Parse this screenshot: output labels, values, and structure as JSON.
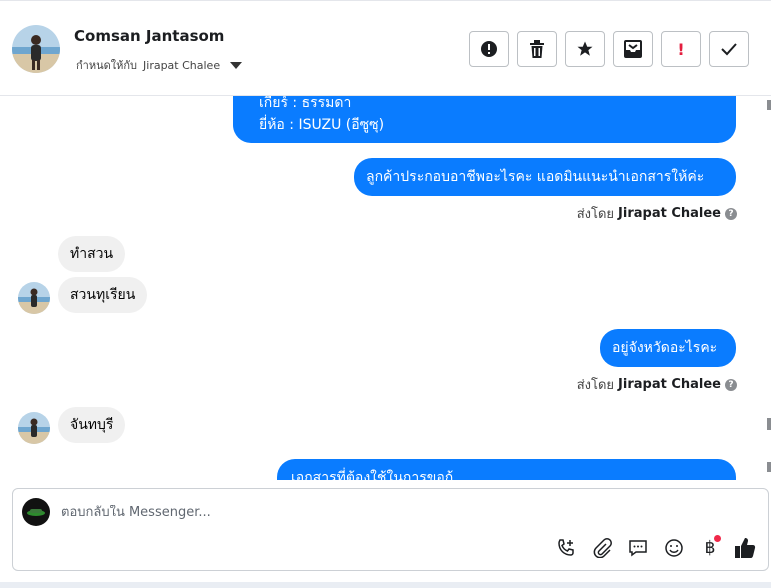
{
  "header": {
    "contact_name": "Comsan Jantasom",
    "assign_prefix": "กำหนดให้กับ",
    "assignee": "Jirapat Chalee",
    "actions": [
      "info-icon",
      "trash-icon",
      "star-icon",
      "archive-icon",
      "exclamation-icon",
      "check-icon"
    ]
  },
  "messages": {
    "out1_line1": "เกียร์ : ธรรมดา",
    "out1_line2": "ยี่ห้อ : ISUZU (อีซูซุ)",
    "out2": "ลูกค้าประกอบอาชีพอะไรคะ แอดมินแนะนำเอกสารให้ค่ะ",
    "sent_by_label": "ส่งโดย",
    "sent_by_name": "Jirapat Chalee",
    "in1": "ทำสวน",
    "in2": "สวนทุเรียน",
    "out3": "อยู่จังหวัดอะไรคะ",
    "in3": "จันทบุรี",
    "out4_partial": "เอกสารที่ต้องใช้ในการขอกู้"
  },
  "composer": {
    "placeholder": "ตอบกลับใน Messenger...",
    "icons": [
      "phone-plus-icon",
      "paperclip-icon",
      "chat-bubble-icon",
      "emoji-icon",
      "baht-icon",
      "thumbs-up-icon"
    ]
  },
  "colors": {
    "accent_blue": "#0a7cff",
    "incoming_gray": "#f0f0f0",
    "notification_dot": "#f02849"
  }
}
